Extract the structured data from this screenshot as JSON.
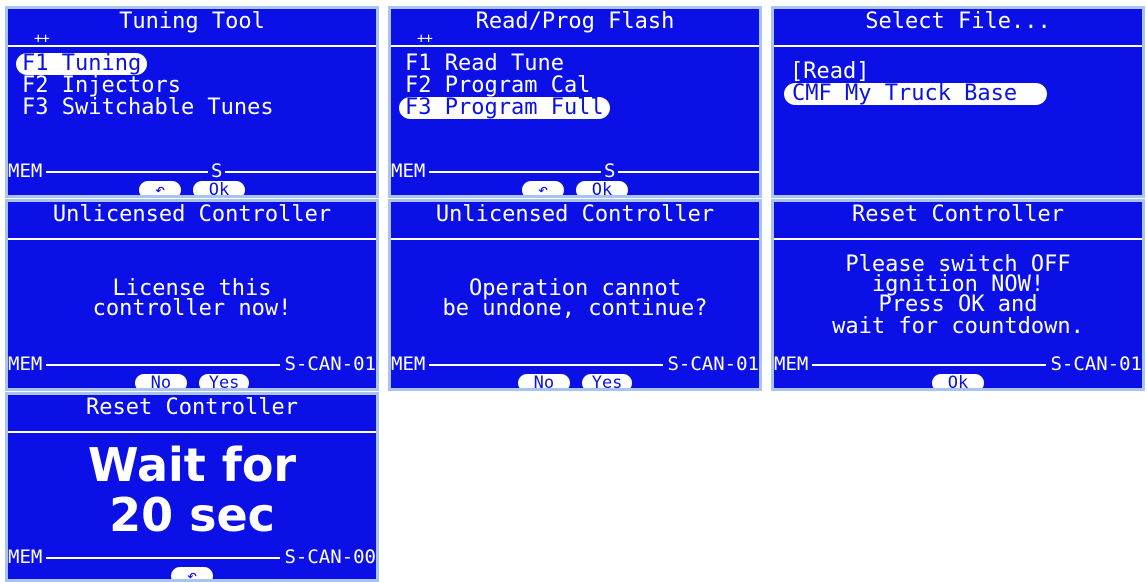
{
  "panels": {
    "tuning_tool": {
      "title": "Tuning Tool",
      "marker": "++",
      "items": [
        "F1 Tuning",
        "F2 Injectors",
        "F3 Switchable Tunes"
      ],
      "status_left": "MEM",
      "status_mid": "S",
      "keys": [
        "↶",
        "Ok"
      ]
    },
    "read_prog": {
      "title": "Read/Prog Flash",
      "marker": "++",
      "items": [
        "F1 Read Tune",
        "F2 Program Cal",
        "F3 Program Full"
      ],
      "status_left": "MEM",
      "status_mid": "S",
      "keys": [
        "↶",
        "Ok"
      ]
    },
    "select_file": {
      "title": "Select File...",
      "items": [
        "[Read]",
        "CMF My Truck Base"
      ]
    },
    "unlicensed_1": {
      "title": "Unlicensed Controller",
      "message": [
        "License this",
        "controller now!"
      ],
      "status_left": "MEM",
      "status_right": "S-CAN-01",
      "keys": [
        "No",
        "Yes"
      ]
    },
    "unlicensed_2": {
      "title": "Unlicensed Controller",
      "message": [
        "Operation cannot",
        "be undone, continue?"
      ],
      "status_left": "MEM",
      "status_right": "S-CAN-01",
      "keys": [
        "No",
        "Yes"
      ]
    },
    "reset_1": {
      "title": "Reset Controller",
      "message": [
        "Please switch OFF",
        "ignition NOW!",
        "Press OK and",
        "wait for countdown."
      ],
      "status_left": "MEM",
      "status_right": "S-CAN-01",
      "keys": [
        "Ok"
      ]
    },
    "reset_2": {
      "title": "Reset Controller",
      "big": [
        "Wait for",
        "20 sec"
      ],
      "status_left": "MEM",
      "status_right": "S-CAN-00",
      "keys": [
        "↶"
      ]
    }
  },
  "colors": {
    "screen_bg": "#0a10e6",
    "frame": "#a9c4ee",
    "text": "#ffffff"
  }
}
